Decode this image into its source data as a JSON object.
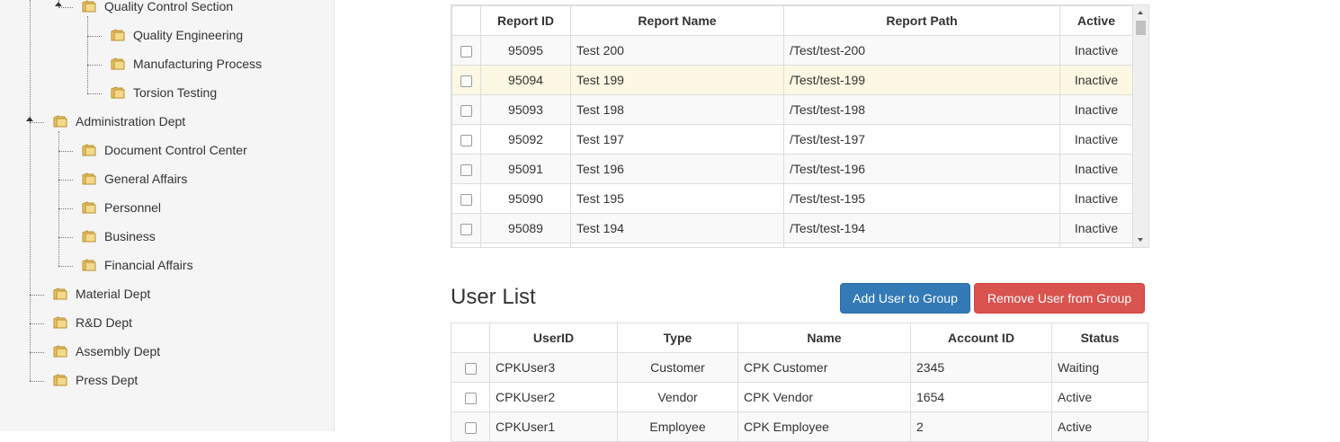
{
  "tree": {
    "nodes": [
      {
        "label": "Quality Control Section"
      },
      {
        "label": "Quality Engineering"
      },
      {
        "label": "Manufacturing Process"
      },
      {
        "label": "Torsion Testing"
      },
      {
        "label": "Administration Dept"
      },
      {
        "label": "Document Control Center"
      },
      {
        "label": "General Affairs"
      },
      {
        "label": "Personnel"
      },
      {
        "label": "Business"
      },
      {
        "label": "Financial Affairs"
      },
      {
        "label": "Material Dept"
      },
      {
        "label": "R&D Dept"
      },
      {
        "label": "Assembly Dept"
      },
      {
        "label": "Press Dept"
      }
    ]
  },
  "report_table": {
    "headers": [
      "Report ID",
      "Report Name",
      "Report Path",
      "Active"
    ],
    "rows": [
      {
        "id": "95095",
        "name": "Test 200",
        "path": "/Test/test-200",
        "active": "Inactive"
      },
      {
        "id": "95094",
        "name": "Test 199",
        "path": "/Test/test-199",
        "active": "Inactive"
      },
      {
        "id": "95093",
        "name": "Test 198",
        "path": "/Test/test-198",
        "active": "Inactive"
      },
      {
        "id": "95092",
        "name": "Test 197",
        "path": "/Test/test-197",
        "active": "Inactive"
      },
      {
        "id": "95091",
        "name": "Test 196",
        "path": "/Test/test-196",
        "active": "Inactive"
      },
      {
        "id": "95090",
        "name": "Test 195",
        "path": "/Test/test-195",
        "active": "Inactive"
      },
      {
        "id": "95089",
        "name": "Test 194",
        "path": "/Test/test-194",
        "active": "Inactive"
      }
    ]
  },
  "user_list": {
    "title": "User List",
    "add_button": "Add User to Group",
    "remove_button": "Remove User from Group",
    "headers": [
      "UserID",
      "Type",
      "Name",
      "Account ID",
      "Status"
    ],
    "rows": [
      {
        "user_id": "CPKUser3",
        "type": "Customer",
        "name": "CPK Customer",
        "account_id": "2345",
        "status": "Waiting"
      },
      {
        "user_id": "CPKUser2",
        "type": "Vendor",
        "name": "CPK Vendor",
        "account_id": "1654",
        "status": "Active"
      },
      {
        "user_id": "CPKUser1",
        "type": "Employee",
        "name": "CPK Employee",
        "account_id": "2",
        "status": "Active"
      }
    ]
  },
  "colors": {
    "primary": "#337ab7",
    "danger": "#d9534f",
    "highlight_row": "#fcf8e3",
    "folder": "#e8c46a"
  }
}
